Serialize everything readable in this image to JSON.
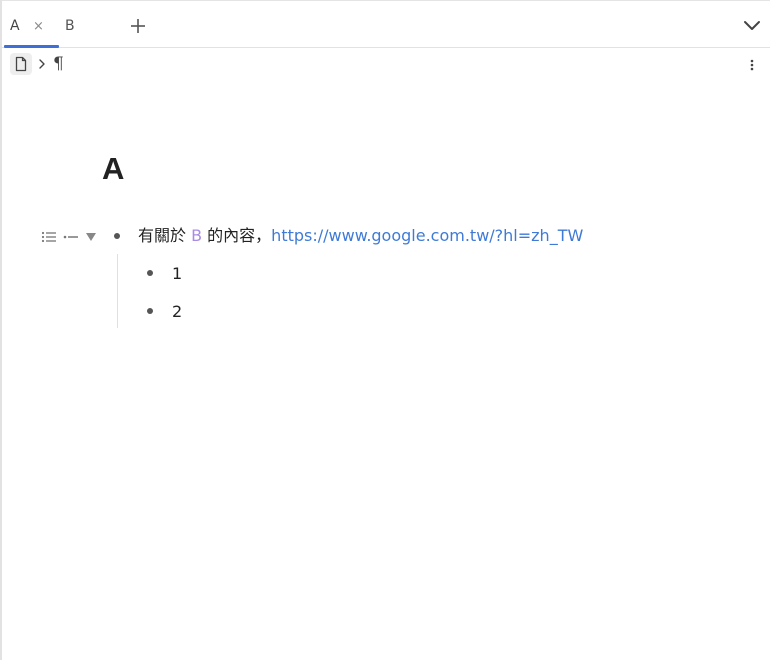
{
  "tabs": [
    {
      "label": "A",
      "close_glyph": "×",
      "active": true
    },
    {
      "label": "B",
      "active": false
    }
  ],
  "tabbar": {
    "add_glyph": "+",
    "dropdown_icon": "chevron-down-icon",
    "accent_color": "#3d6fd6"
  },
  "breadcrumb": {
    "doc_icon": "document-icon",
    "separator_icon": "chevron-right-icon",
    "block_glyph": "¶"
  },
  "toolbar": {
    "more_icon": "kebab-menu-icon"
  },
  "page": {
    "title": "A",
    "block_tools": [
      "list-icon",
      "dash-list-icon",
      "collapse-triangle-icon"
    ],
    "main_item": {
      "prefix": "有關於 ",
      "ref": "B",
      "middle": " 的內容，",
      "link_text": "https://www.google.com.tw/?hl=zh_TW",
      "ref_color": "#a98be6",
      "link_color": "#3f7bd6"
    },
    "children": [
      "1",
      "2"
    ]
  }
}
